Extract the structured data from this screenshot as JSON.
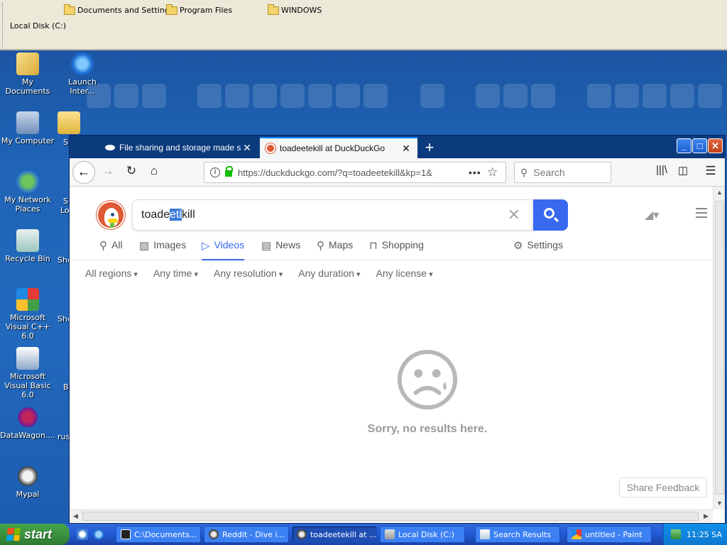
{
  "explorer_bar": {
    "links": [
      "Documents and Settings",
      "Program Files",
      "WINDOWS"
    ],
    "drive_label": "Local Disk (C:)"
  },
  "desktop_icons": [
    {
      "label": "My Documents",
      "icon": "my-documents-icon"
    },
    {
      "label": "Launch Inter...",
      "icon": "internet-explorer-icon"
    },
    {
      "label": "My Computer",
      "icon": "my-computer-icon"
    },
    {
      "label": "My Network Places",
      "icon": "network-places-icon"
    },
    {
      "label": "Recycle Bin",
      "icon": "recycle-bin-icon"
    },
    {
      "label": "Microsoft Visual C++ 6.0",
      "icon": "visual-cpp-icon"
    },
    {
      "label": "Microsoft Visual Basic 6.0",
      "icon": "visual-basic-icon"
    },
    {
      "label": "DataWagon....",
      "icon": "datawagon-icon"
    },
    {
      "label": "Mypal",
      "icon": "mypal-icon"
    }
  ],
  "desktop_partial_labels": [
    "S",
    "S",
    "Lo",
    "She",
    "She",
    "B",
    "rus"
  ],
  "browser": {
    "tabs": [
      {
        "title": "File sharing and storage made simple",
        "active": false
      },
      {
        "title": "toadeetekill at DuckDuckGo",
        "active": true
      }
    ],
    "url": "https://duckduckgo.com/?q=toadeetekill&kp=1&",
    "search_placeholder": "Search"
  },
  "ddg": {
    "query_before": "toade",
    "query_selected": "eti",
    "query_after": "kill",
    "nav_tabs": [
      {
        "label": "All",
        "icon": "search-icon",
        "active": false
      },
      {
        "label": "Images",
        "icon": "image-icon",
        "active": false
      },
      {
        "label": "Videos",
        "icon": "play-icon",
        "active": true
      },
      {
        "label": "News",
        "icon": "news-icon",
        "active": false
      },
      {
        "label": "Maps",
        "icon": "map-pin-icon",
        "active": false
      },
      {
        "label": "Shopping",
        "icon": "shopping-bag-icon",
        "active": false
      }
    ],
    "settings_label": "Settings",
    "filters": [
      "All regions",
      "Any time",
      "Any resolution",
      "Any duration",
      "Any license"
    ],
    "no_results": "Sorry, no results here.",
    "feedback": "Share Feedback"
  },
  "taskbar": {
    "start_label": "start",
    "items": [
      {
        "label": "C:\\Documents...",
        "icon": "7zip-icon",
        "active": false
      },
      {
        "label": "Reddit - Dive i...",
        "icon": "mypal-icon",
        "active": false
      },
      {
        "label": "toadeetekill at ...",
        "icon": "mypal-icon",
        "active": true
      },
      {
        "label": "Local Disk (C:)",
        "icon": "drive-icon",
        "active": false
      },
      {
        "label": "Search Results",
        "icon": "search-results-icon",
        "active": false
      },
      {
        "label": "untitled - Paint",
        "icon": "paint-icon",
        "active": false
      }
    ],
    "clock": "11:25 SA"
  },
  "colors": {
    "ddg_blue": "#3969ef",
    "ddg_orange": "#de5833",
    "xp_blue": "#245edb",
    "xp_start_green": "#388e3c"
  }
}
